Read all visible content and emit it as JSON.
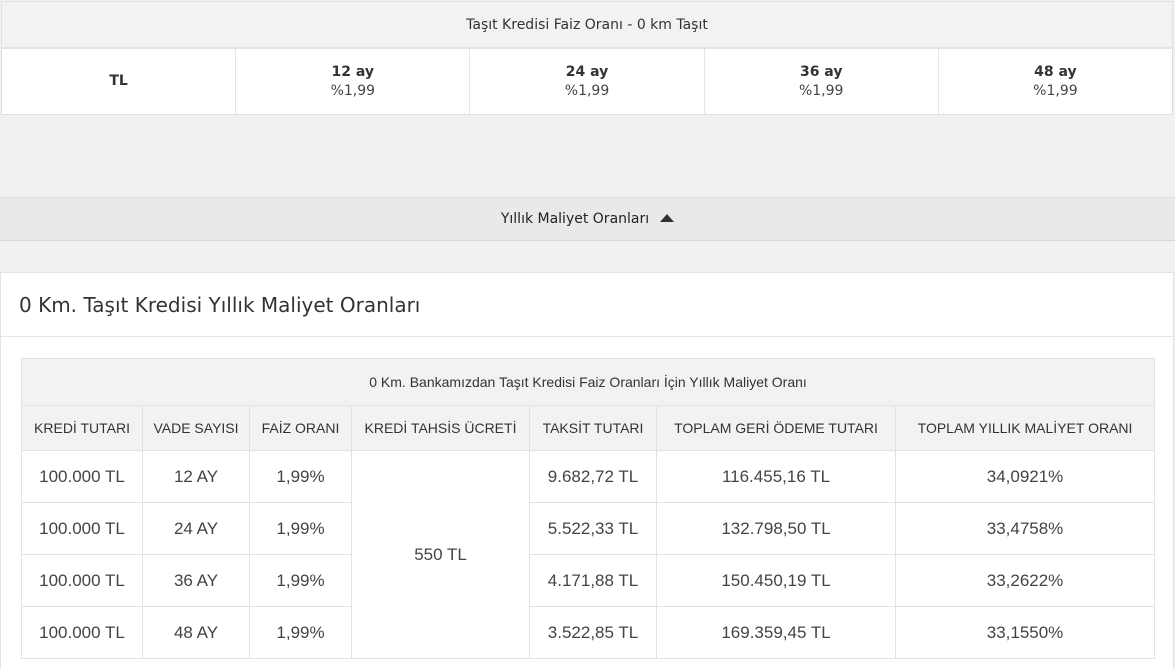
{
  "rate_table": {
    "title": "Taşıt Kredisi Faiz Oranı - 0 km Taşıt",
    "currency": "TL",
    "terms": [
      {
        "term": "12 ay",
        "rate": "%1,99"
      },
      {
        "term": "24 ay",
        "rate": "%1,99"
      },
      {
        "term": "36 ay",
        "rate": "%1,99"
      },
      {
        "term": "48 ay",
        "rate": "%1,99"
      }
    ]
  },
  "accordion": {
    "label": "Yıllık Maliyet Oranları",
    "icon": "caret-up-icon"
  },
  "cost_panel": {
    "heading": "0 Km. Taşıt Kredisi Yıllık Maliyet Oranları",
    "table": {
      "caption": "0 Km. Bankamızdan Taşıt Kredisi Faiz Oranları İçin Yıllık Maliyet Oranı",
      "columns": [
        "KREDİ TUTARI",
        "VADE SAYISI",
        "FAİZ ORANI",
        "KREDİ TAHSİS ÜCRETİ",
        "TAKSİT TUTARI",
        "TOPLAM GERİ ÖDEME TUTARI",
        "TOPLAM YILLIK MALİYET ORANI"
      ],
      "allocation_fee": "550 TL",
      "rows": [
        {
          "amount": "100.000 TL",
          "term": "12 AY",
          "rate": "1,99%",
          "installment": "9.682,72 TL",
          "total": "116.455,16 TL",
          "annual_cost": "34,0921%"
        },
        {
          "amount": "100.000 TL",
          "term": "24 AY",
          "rate": "1,99%",
          "installment": "5.522,33 TL",
          "total": "132.798,50 TL",
          "annual_cost": "33,4758%"
        },
        {
          "amount": "100.000 TL",
          "term": "36 AY",
          "rate": "1,99%",
          "installment": "4.171,88 TL",
          "total": "150.450,19 TL",
          "annual_cost": "33,2622%"
        },
        {
          "amount": "100.000 TL",
          "term": "48 AY",
          "rate": "1,99%",
          "installment": "3.522,85 TL",
          "total": "169.359,45 TL",
          "annual_cost": "33,1550%"
        }
      ]
    }
  }
}
